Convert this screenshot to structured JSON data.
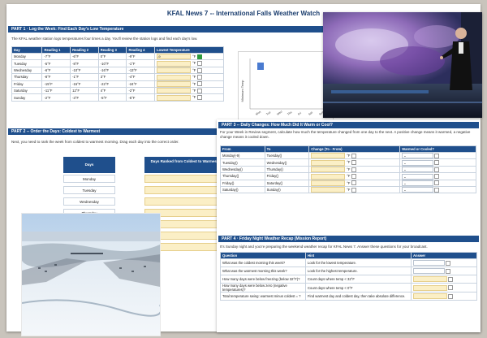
{
  "doc": {
    "title": "KFAL News 7 -- International Falls Weather Watch",
    "part1": {
      "bar": "PART 1 · Log the Week: Find Each Day's Low Temperature",
      "intro": "The KFAL weather station logs temperatures four times a day. You'll review the station logs and find each day's low.",
      "headers": [
        "Day",
        "Reading 1",
        "Reading 2",
        "Reading 3",
        "Reading 4",
        "Lowest Temperature"
      ],
      "rows": [
        [
          "Monday",
          "-7°F",
          "-6°F",
          "0°F",
          "-9°F",
          "-9"
        ],
        [
          "Tuesday",
          "-5°F",
          "-8°F",
          "-10°F",
          "-1°F",
          ""
        ],
        [
          "Wednesday",
          "-6°F",
          "-10°F",
          "-16°F",
          "-13°F",
          ""
        ],
        [
          "Thursday",
          "-8°F",
          "-1°F",
          "3°F",
          "-4°F",
          ""
        ],
        [
          "Friday",
          "-15°F",
          "-15°F",
          "-22°F",
          "-24°F",
          ""
        ],
        [
          "Saturday",
          "-11°F",
          "12°F",
          "4°F",
          "-2°F",
          ""
        ],
        [
          "Sunday",
          "-2°F",
          "-3°F",
          "-5°F",
          "-5°F",
          ""
        ]
      ],
      "unit": "°F"
    },
    "chart": {
      "ylabel": "Minimum Temp",
      "legend": "Minimum Temp",
      "xticks": [
        "Mon",
        "Tue",
        "Wed",
        "Thu",
        "Fri",
        "Sat",
        "Sun"
      ]
    },
    "part2": {
      "bar": "PART 2 -- Order the Days: Coldest to Warmest",
      "intro": "Next, you need to rank the week from coldest to warmest morning. Drag each day into the correct order.",
      "days_header": "Days",
      "rank_header": "Days Ranked from Coldest to Warmest",
      "days": [
        "Monday",
        "Tuesday",
        "Wednesday",
        "Thursday"
      ]
    },
    "part3": {
      "bar": "PART 3 -- Daily Changes: How Much Did It Warm or Cool?",
      "intro": "For your Week in Review segment, calculate how much the temperature changed from one day to the next. A positive change means it warmed, a negative change means it cooled down.",
      "headers": [
        "From",
        "To",
        "Change (To - From)",
        "Warmed or Cooled?"
      ],
      "rows": [
        [
          "Monday(-9)",
          "Tuesday()"
        ],
        [
          "Tuesday()",
          "Wednesday()"
        ],
        [
          "Wednesday()",
          "Thursday()"
        ],
        [
          "Thursday()",
          "Friday()"
        ],
        [
          "Friday()",
          "Saturday()"
        ],
        [
          "Saturday()",
          "Sunday()"
        ]
      ],
      "unit": "°F"
    },
    "part4": {
      "bar": "PART 4 · Friday Night Weather Recap (Mission Report)",
      "intro": "It's Sunday night and you're preparing the weekend weather recap for KFAL News 7. Answer these questions for your broadcast.",
      "headers": [
        "Question",
        "Hint",
        "Answer"
      ],
      "rows": [
        [
          "What was the coldest morning this week?",
          "Look for the lowest temperature."
        ],
        [
          "What was the warmest morning this week?",
          "Look for the highest temperature."
        ],
        [
          "How many days were below freezing (below 32°F)?",
          "Count days where temp < 32°F"
        ],
        [
          "How many days were below zero (negative temperatures)?",
          "Count days where temp < 0°F"
        ],
        [
          "Total temperature swing: warmest minus coldest = ?",
          "Find warmest day and coldest day, then take absolute difference."
        ]
      ]
    }
  }
}
